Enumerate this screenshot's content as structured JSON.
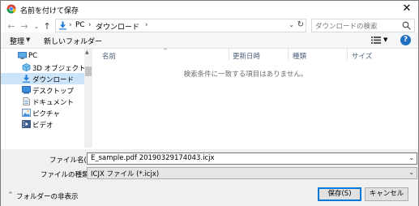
{
  "window": {
    "title": "名前を付けて保存",
    "close_glyph": "✕"
  },
  "address": {
    "back_glyph": "←",
    "forward_glyph": "→",
    "recent_glyph": "⌄",
    "up_glyph": "↑",
    "crumbs": [
      "PC",
      "ダウンロード"
    ],
    "separator": "›",
    "dropdown_glyph": "⌄",
    "refresh_glyph": "↻"
  },
  "search": {
    "placeholder": "ダウンロードの検索"
  },
  "toolbar": {
    "organize_label": "整理",
    "organize_dd": "▼",
    "new_folder_label": "新しいフォルダー",
    "view_dd": "▼",
    "help_glyph": "?"
  },
  "nav": {
    "items": [
      {
        "label": "PC",
        "icon": "computer-icon"
      },
      {
        "label": "3D オブジェクト",
        "icon": "cube-icon"
      },
      {
        "label": "ダウンロード",
        "icon": "download-icon",
        "selected": true
      },
      {
        "label": "デスクトップ",
        "icon": "desktop-icon"
      },
      {
        "label": "ドキュメント",
        "icon": "document-icon"
      },
      {
        "label": "ピクチャ",
        "icon": "picture-icon"
      },
      {
        "label": "ビデオ",
        "icon": "video-icon"
      }
    ],
    "scroll_up_glyph": "▲"
  },
  "filelist": {
    "columns": [
      "名前",
      "更新日時",
      "種類",
      "サイズ"
    ],
    "sort_glyph": "^",
    "empty_message": "検索条件に一致する項目はありません。"
  },
  "form": {
    "filename_label": "ファイル名(N):",
    "filename_value": "E_sample.pdf 20190329174043.icjx",
    "filename_dd": "⌄",
    "filetype_label": "ファイルの種類(T):",
    "filetype_value": "ICJX ファイル (*.icjx)",
    "filetype_dd": "⌄"
  },
  "footer": {
    "hide_folders_chevron": "^",
    "hide_folders_label": "フォルダーの非表示",
    "save_label": "保存(S)",
    "cancel_label": "キャンセル"
  },
  "colors": {
    "selection": "#cce4f7",
    "accent": "#0078d7",
    "form_bg": "#f0f0f0"
  }
}
